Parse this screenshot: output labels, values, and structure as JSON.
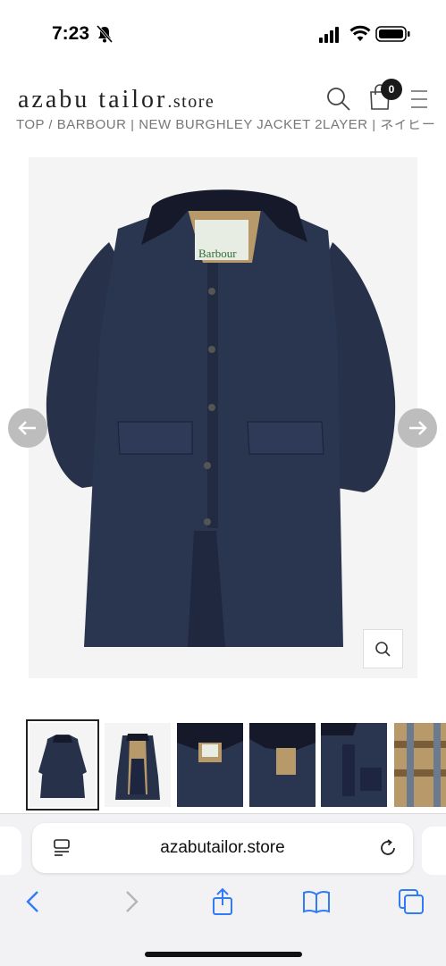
{
  "status_bar": {
    "time": "7:23"
  },
  "header": {
    "logo_main": "azabu tailor",
    "logo_suffix": ".store",
    "cart_count": "0"
  },
  "breadcrumb": "TOP / BARBOUR | NEW BURGHLEY JACKET 2LAYER | ネイビー",
  "product_image": {
    "alt": "Barbour navy coat front view",
    "label_text": "Barbour"
  },
  "thumbnails": [
    {
      "name": "front view"
    },
    {
      "name": "open lining view"
    },
    {
      "name": "collar detail"
    },
    {
      "name": "collar detail 2"
    },
    {
      "name": "pocket detail"
    },
    {
      "name": "tartan lining detail"
    }
  ],
  "browser": {
    "url": "azabutailor.store"
  },
  "colors": {
    "coat": "#27324a",
    "collar": "#15192a",
    "tartan": "#b89a6a",
    "arrow_bg": "#bdbdbd",
    "safari_blue": "#2f7cf6"
  }
}
